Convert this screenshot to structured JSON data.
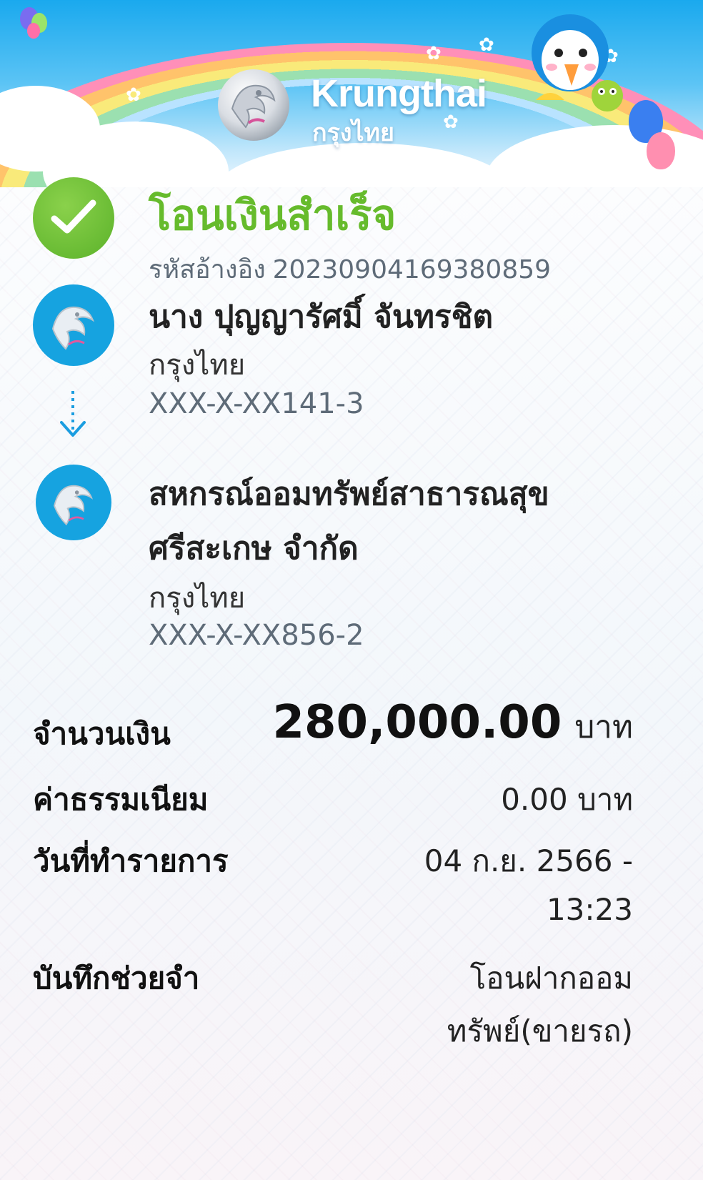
{
  "header": {
    "brand_en": "Krungthai",
    "brand_th": "กรุงไทย"
  },
  "status": {
    "title": "โอนเงินสำเร็จ",
    "ref_label": "รหัสอ้างอิง",
    "ref_value": "2023090416938085​9"
  },
  "sender": {
    "name": "นาง ปุญญารัศมิ์ จันทรชิต",
    "bank": "กรุงไทย",
    "account": "XXX-X-XX141-3"
  },
  "receiver": {
    "name_line1": "สหกรณ์ออมทรัพย์สาธารณสุข",
    "name_line2": "ศรีสะเกษ จำกัด",
    "bank": "กรุงไทย",
    "account": "XXX-X-XX856-2"
  },
  "details": {
    "amount_label": "จำนวนเงิน",
    "amount_value": "280,000.00",
    "amount_unit": "บาท",
    "fee_label": "ค่าธรรมเนียม",
    "fee_value": "0.00 บาท",
    "date_label": "วันที่ทำรายการ",
    "date_line1": "04 ก.ย. 2566 -",
    "date_line2": "13:23",
    "memo_label": "บันทึกช่วยจำ",
    "memo_line1": "โอนฝากออม",
    "memo_line2": "ทรัพย์(ขายรถ)"
  },
  "colors": {
    "success_green": "#66bb2c",
    "bank_blue": "#16a3e0"
  },
  "icons": {
    "success": "check-icon",
    "bank": "krungthai-logo-icon",
    "direction": "arrow-down-icon"
  }
}
